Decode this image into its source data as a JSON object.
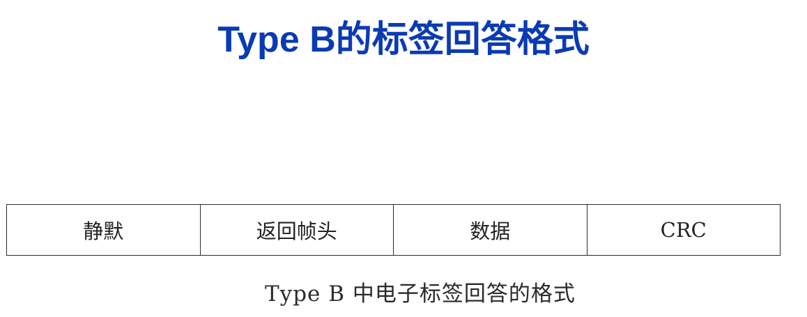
{
  "title": "Type B的标签回答格式",
  "frame": {
    "fields": [
      "静默",
      "返回帧头",
      "数据",
      "CRC"
    ]
  },
  "caption": "Type B 中电子标签回答的格式",
  "colors": {
    "title": "#0b3bb3",
    "border": "#2a2a2a",
    "text": "#222222"
  }
}
